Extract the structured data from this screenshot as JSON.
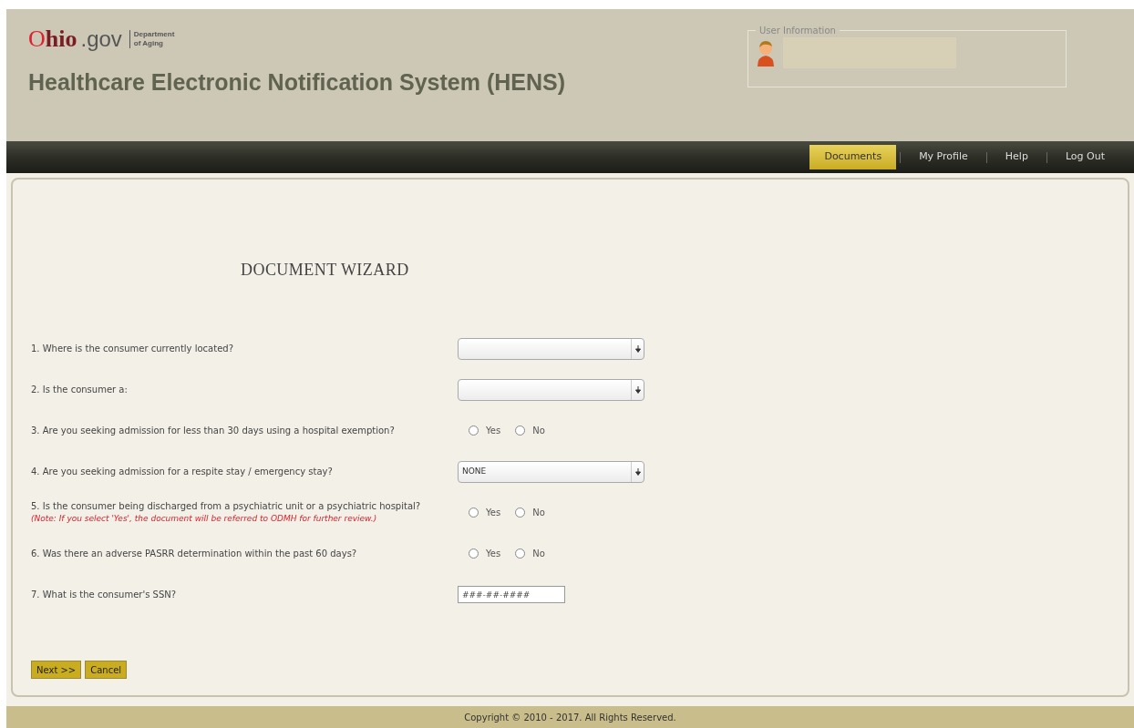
{
  "header": {
    "logo": {
      "word": "Ohio",
      "suffix": ".gov",
      "department": [
        "Department",
        "of Aging"
      ]
    },
    "title": "Healthcare Electronic Notification System (HENS)",
    "user_info": {
      "legend": "User Information"
    }
  },
  "nav": [
    {
      "label": "Documents",
      "selected": true
    },
    {
      "label": "My Profile",
      "selected": false
    },
    {
      "label": "Help",
      "selected": false
    },
    {
      "label": "Log Out",
      "selected": false
    }
  ],
  "wizard": {
    "title": "DOCUMENT WIZARD",
    "questions": [
      {
        "kind": "select",
        "label": "1. Where is the consumer currently located?"
      },
      {
        "kind": "select",
        "label": "2. Is the consumer a:"
      },
      {
        "kind": "radio",
        "label": "3. Are you seeking admission for less than 30 days using a hospital exemption?",
        "options": [
          {
            "label": "Yes",
            "selected": false
          },
          {
            "label": "No",
            "selected": false
          }
        ]
      },
      {
        "kind": "select",
        "label": "4. Are you seeking admission for a respite stay / emergency stay?",
        "value": "NONE"
      },
      {
        "kind": "radio",
        "label": "5. Is the consumer being discharged from a psychiatric unit or a psychiatric hospital?",
        "note": "(Note: If you select 'Yes', the document will be referred to ODMH for further review.)",
        "options": [
          {
            "label": "Yes",
            "selected": false
          },
          {
            "label": "No",
            "selected": false
          }
        ]
      },
      {
        "kind": "radio",
        "label": "6. Was there an adverse PASRR determination within the past 60 days?",
        "options": [
          {
            "label": "Yes",
            "selected": false
          },
          {
            "label": "No",
            "selected": false
          }
        ]
      },
      {
        "kind": "text",
        "label": "7. What is the consumer's SSN?",
        "placeholder": "###-##-####"
      }
    ],
    "buttons": [
      "Next >>",
      "Cancel"
    ]
  },
  "footer": "Copyright © 2010 - 2017. All Rights Reserved."
}
